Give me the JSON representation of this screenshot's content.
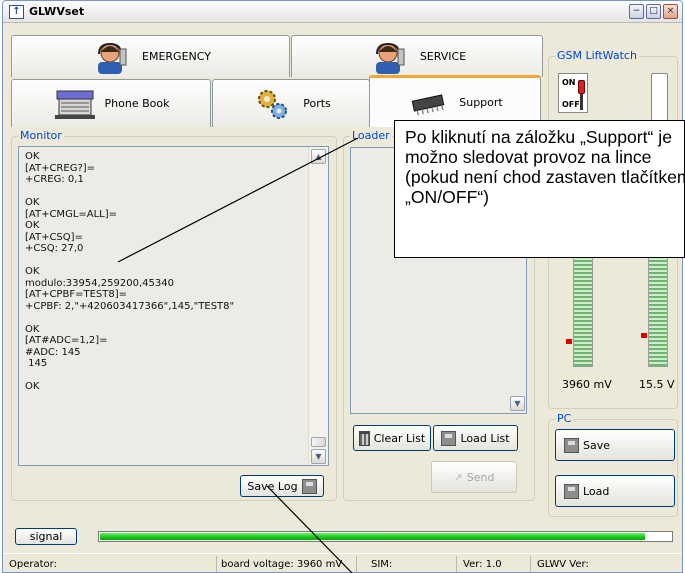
{
  "window": {
    "title": "GLWVset",
    "minimize_glyph": "−",
    "maximize_glyph": "□",
    "close_glyph": "×"
  },
  "tabs_top": [
    {
      "label": "EMERGENCY",
      "icon": "operator-headset-icon"
    },
    {
      "label": "SERVICE",
      "icon": "operator-headset-icon"
    }
  ],
  "tabs_bottom": [
    {
      "label": "Phone Book",
      "icon": "phonebook-icon"
    },
    {
      "label": "Ports",
      "icon": "gears-icon"
    },
    {
      "label": "Support",
      "icon": "chip-icon",
      "active": true
    }
  ],
  "monitor": {
    "label": "Monitor",
    "log_lines": [
      "OK",
      "[AT+CREG?]=",
      "+CREG: 0,1",
      "",
      "OK",
      "[AT+CMGL=ALL]=",
      "OK",
      "[AT+CSQ]=",
      "+CSQ: 27,0",
      "",
      "OK",
      "modulo:33954,259200,45340",
      "[AT+CPBF=TEST8]=",
      "+CPBF: 2,\"+420603417366\",145,\"TEST8\"",
      "",
      "OK",
      "[AT#ADC=1,2]=",
      "#ADC: 145",
      " 145",
      "",
      "OK"
    ],
    "save_log_label": "Save Log"
  },
  "loader": {
    "label": "Loader",
    "clear_list_label": "Clear List",
    "load_list_label": "Load List",
    "send_label": "Send"
  },
  "gsm": {
    "label": "GSM LiftWatch",
    "toggle_on": "ON",
    "toggle_off": "OFF",
    "voltage_reading": "3960 mV",
    "supply_reading": "15.5 V"
  },
  "pc": {
    "label": "PC",
    "save_label": "Save",
    "load_label": "Load"
  },
  "signal": {
    "label": "signal",
    "level_fraction": 0.955
  },
  "statusbar": {
    "operator": "Operator:",
    "board_voltage": "board voltage: 3960 mV",
    "sim": "SIM:",
    "version": "Ver: 1.0",
    "glwv_version": "GLWV Ver:"
  },
  "callout": {
    "text": "Po kliknutí na záložku „Support“ je\nmožno sledovat provoz na lince\n(pokud není chod zastaven tlačítkem\n„ON/OFF“)"
  },
  "colors": {
    "accent_tab": "#f0a830",
    "group_label": "#0046d5",
    "progress_fill": "#14c814",
    "meter_marker": "#e00000"
  }
}
